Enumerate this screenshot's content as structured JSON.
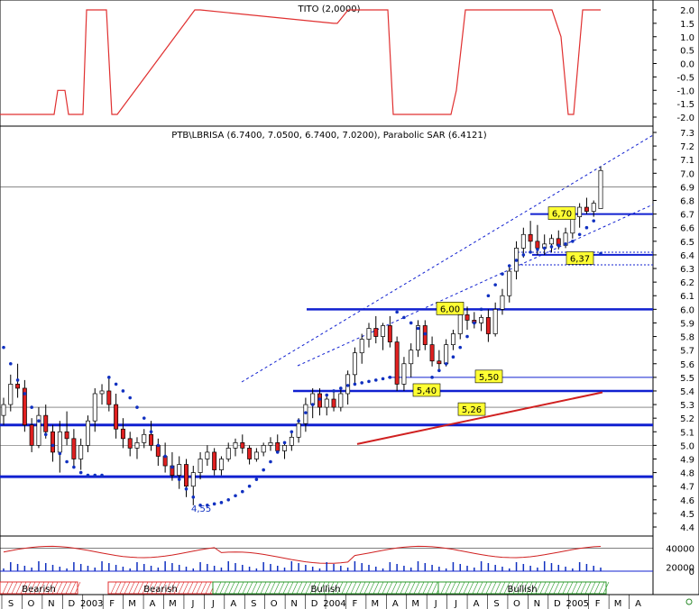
{
  "chart_data": [
    {
      "type": "line",
      "title": "TITO (2,0000)",
      "ylim": [
        -2.0,
        2.0
      ],
      "y_ticks": [
        "2.0",
        "1.5",
        "1.0",
        "0.5",
        "0.0",
        "-0.5",
        "-1.0",
        "-1.5",
        "-2.0"
      ],
      "colors": {
        "line": "#e03030"
      },
      "series": [
        {
          "x": [
            0,
            60,
            64,
            72,
            76,
            92,
            96,
            118,
            124,
            130,
            216,
            222,
            370,
            374,
            386,
            430,
            436,
            500,
            506,
            516,
            612,
            622,
            630,
            636,
            646,
            666
          ],
          "values": [
            -1.9,
            -1.9,
            -1.0,
            -1.0,
            -1.9,
            -1.9,
            2.0,
            2.0,
            -1.9,
            -1.9,
            2.0,
            2.0,
            1.5,
            1.5,
            2.0,
            2.0,
            -1.9,
            -1.9,
            -1.0,
            2.0,
            2.0,
            1.0,
            -1.9,
            -1.9,
            2.0,
            2.0
          ]
        }
      ]
    },
    {
      "type": "candlestick",
      "title": "PTB\\LBRISA (6.7400, 7.0500, 6.7400, 7.0200), Parabolic SAR (6.4121)",
      "ylim": [
        4.4,
        7.3
      ],
      "y_ticks": [
        "7.3",
        "7.2",
        "7.1",
        "7.0",
        "6.9",
        "6.8",
        "6.7",
        "6.6",
        "6.5",
        "6.4",
        "6.3",
        "6.2",
        "6.1",
        "6.0",
        "5.9",
        "5.8",
        "5.7",
        "5.6",
        "5.5",
        "5.4",
        "5.3",
        "5.2",
        "5.1",
        "5.0",
        "4.9",
        "4.8",
        "4.7",
        "4.6",
        "4.5",
        "4.4"
      ],
      "colors": {
        "up": "#ffffff",
        "down": "#e02020",
        "sar": "#1030c0",
        "level": "#1020d0",
        "ma": "#d02020"
      },
      "ohlc": [
        [
          5.22,
          5.35,
          5.15,
          5.3
        ],
        [
          5.3,
          5.52,
          5.25,
          5.45
        ],
        [
          5.45,
          5.6,
          5.35,
          5.42
        ],
        [
          5.42,
          5.48,
          5.1,
          5.15
        ],
        [
          5.15,
          5.2,
          4.95,
          5.0
        ],
        [
          5.0,
          5.28,
          4.98,
          5.22
        ],
        [
          5.22,
          5.3,
          5.05,
          5.1
        ],
        [
          5.1,
          5.15,
          4.88,
          4.95
        ],
        [
          4.95,
          5.18,
          4.8,
          5.1
        ],
        [
          5.1,
          5.25,
          5.0,
          5.05
        ],
        [
          5.05,
          5.12,
          4.85,
          4.9
        ],
        [
          4.9,
          5.05,
          4.82,
          5.0
        ],
        [
          5.0,
          5.22,
          4.95,
          5.18
        ],
        [
          5.18,
          5.42,
          5.1,
          5.38
        ],
        [
          5.38,
          5.45,
          5.3,
          5.4
        ],
        [
          5.4,
          5.5,
          5.25,
          5.3
        ],
        [
          5.3,
          5.38,
          5.05,
          5.12
        ],
        [
          5.12,
          5.2,
          4.98,
          5.05
        ],
        [
          5.05,
          5.1,
          4.92,
          4.98
        ],
        [
          4.98,
          5.06,
          4.9,
          5.02
        ],
        [
          5.02,
          5.12,
          4.98,
          5.08
        ],
        [
          5.08,
          5.18,
          4.96,
          5.0
        ],
        [
          5.0,
          5.05,
          4.85,
          4.92
        ],
        [
          4.92,
          5.02,
          4.8,
          4.85
        ],
        [
          4.85,
          4.95,
          4.74,
          4.78
        ],
        [
          4.78,
          4.92,
          4.68,
          4.86
        ],
        [
          4.86,
          4.9,
          4.62,
          4.7
        ],
        [
          4.7,
          4.85,
          4.56,
          4.8
        ],
        [
          4.8,
          4.95,
          4.75,
          4.9
        ],
        [
          4.9,
          5.0,
          4.85,
          4.95
        ],
        [
          4.95,
          4.98,
          4.78,
          4.82
        ],
        [
          4.82,
          4.92,
          4.78,
          4.9
        ],
        [
          4.9,
          5.02,
          4.88,
          4.98
        ],
        [
          4.98,
          5.05,
          4.92,
          5.02
        ],
        [
          5.02,
          5.08,
          4.94,
          4.98
        ],
        [
          4.98,
          5.0,
          4.86,
          4.9
        ],
        [
          4.9,
          4.98,
          4.88,
          4.95
        ],
        [
          4.95,
          5.02,
          4.92,
          5.0
        ],
        [
          5.0,
          5.06,
          4.96,
          5.02
        ],
        [
          5.02,
          5.08,
          4.98,
          4.96
        ],
        [
          4.96,
          5.02,
          4.9,
          5.0
        ],
        [
          5.0,
          5.1,
          4.96,
          5.06
        ],
        [
          5.06,
          5.2,
          5.02,
          5.16
        ],
        [
          5.16,
          5.35,
          5.1,
          5.3
        ],
        [
          5.3,
          5.42,
          5.2,
          5.38
        ],
        [
          5.38,
          5.42,
          5.22,
          5.28
        ],
        [
          5.28,
          5.38,
          5.22,
          5.34
        ],
        [
          5.34,
          5.4,
          5.25,
          5.28
        ],
        [
          5.28,
          5.42,
          5.25,
          5.38
        ],
        [
          5.38,
          5.55,
          5.3,
          5.52
        ],
        [
          5.52,
          5.72,
          5.45,
          5.68
        ],
        [
          5.68,
          5.82,
          5.6,
          5.78
        ],
        [
          5.78,
          5.9,
          5.72,
          5.86
        ],
        [
          5.86,
          5.95,
          5.75,
          5.8
        ],
        [
          5.8,
          5.9,
          5.7,
          5.88
        ],
        [
          5.88,
          5.95,
          5.72,
          5.76
        ],
        [
          5.76,
          5.8,
          5.4,
          5.45
        ],
        [
          5.45,
          5.65,
          5.4,
          5.6
        ],
        [
          5.6,
          5.75,
          5.5,
          5.7
        ],
        [
          5.7,
          5.92,
          5.65,
          5.88
        ],
        [
          5.88,
          5.92,
          5.7,
          5.74
        ],
        [
          5.74,
          5.8,
          5.58,
          5.62
        ],
        [
          5.62,
          5.7,
          5.55,
          5.6
        ],
        [
          5.6,
          5.78,
          5.58,
          5.74
        ],
        [
          5.74,
          5.85,
          5.7,
          5.82
        ],
        [
          5.82,
          6.0,
          5.78,
          5.96
        ],
        [
          5.96,
          6.02,
          5.85,
          5.92
        ],
        [
          5.92,
          5.98,
          5.86,
          5.9
        ],
        [
          5.9,
          5.96,
          5.84,
          5.94
        ],
        [
          5.94,
          6.0,
          5.76,
          5.82
        ],
        [
          5.82,
          6.05,
          5.8,
          6.0
        ],
        [
          6.0,
          6.15,
          5.96,
          6.1
        ],
        [
          6.1,
          6.32,
          6.05,
          6.28
        ],
        [
          6.28,
          6.5,
          6.22,
          6.45
        ],
        [
          6.45,
          6.6,
          6.38,
          6.55
        ],
        [
          6.55,
          6.65,
          6.42,
          6.5
        ],
        [
          6.5,
          6.62,
          6.4,
          6.45
        ],
        [
          6.45,
          6.55,
          6.4,
          6.48
        ],
        [
          6.48,
          6.55,
          6.42,
          6.52
        ],
        [
          6.52,
          6.58,
          6.44,
          6.47
        ],
        [
          6.47,
          6.6,
          6.45,
          6.56
        ],
        [
          6.56,
          6.7,
          6.52,
          6.68
        ],
        [
          6.68,
          6.78,
          6.6,
          6.75
        ],
        [
          6.75,
          6.82,
          6.7,
          6.72
        ],
        [
          6.72,
          6.8,
          6.68,
          6.78
        ],
        [
          6.74,
          7.05,
          6.74,
          7.02
        ]
      ],
      "sar": [
        5.72,
        5.6,
        5.48,
        5.38,
        5.28,
        5.18,
        5.08,
        5.0,
        4.94,
        4.88,
        4.84,
        4.8,
        4.78,
        4.78,
        4.78,
        5.5,
        5.45,
        5.4,
        5.35,
        5.28,
        5.2,
        5.1,
        5.0,
        4.92,
        4.84,
        4.75,
        4.68,
        4.62,
        4.56,
        4.56,
        4.57,
        4.58,
        4.6,
        4.63,
        4.66,
        4.7,
        4.75,
        4.82,
        4.88,
        4.95,
        5.02,
        5.1,
        5.18,
        5.24,
        5.3,
        5.34,
        5.37,
        5.4,
        5.42,
        5.44,
        5.45,
        5.46,
        5.47,
        5.48,
        5.49,
        5.5,
        5.98,
        5.94,
        5.9,
        5.86,
        5.82,
        5.5,
        5.55,
        5.6,
        5.65,
        5.72,
        5.8,
        5.9,
        6.0,
        6.1,
        6.18,
        6.26,
        6.32,
        6.36,
        6.4,
        6.42,
        6.44,
        6.45,
        6.46,
        6.47,
        6.48,
        6.5,
        6.55,
        6.6,
        6.65,
        6.41
      ],
      "levels": [
        {
          "value": 6.0,
          "label": "6,00"
        },
        {
          "value": 6.7,
          "label": "6,70"
        },
        {
          "value": 6.4,
          "label": "6,37"
        },
        {
          "value": 5.4,
          "label": "5,40"
        },
        {
          "value": 5.5,
          "label": "5,50"
        },
        {
          "value": 5.15,
          "label": "5,26"
        },
        {
          "value": 4.77,
          "label": ""
        }
      ],
      "annotations": [
        "4,55"
      ],
      "ma_line": [
        [
          5.01,
          5.1
        ],
        [
          5.4,
          5.39
        ]
      ]
    },
    {
      "type": "line",
      "title": "",
      "ylim": [
        10000,
        50000
      ],
      "y_ticks": [
        "40000",
        "20000",
        "0"
      ],
      "colors": {
        "line": "#d02020",
        "volume": "#1030c0"
      }
    }
  ],
  "time_axis": {
    "labels": [
      "S",
      "O",
      "N",
      "D",
      "2003",
      "F",
      "M",
      "A",
      "M",
      "J",
      "J",
      "A",
      "S",
      "O",
      "N",
      "D",
      "2004",
      "F",
      "M",
      "A",
      "M",
      "J",
      "J",
      "A",
      "S",
      "O",
      "N",
      "D",
      "2005",
      "F",
      "M",
      "A"
    ]
  },
  "phases": [
    {
      "label": "Bearish",
      "type": "bearish"
    },
    {
      "label": "Bearish",
      "type": "bearish"
    },
    {
      "label": "Bullish",
      "type": "bullish"
    },
    {
      "label": "Bullish",
      "type": "bullish"
    }
  ]
}
